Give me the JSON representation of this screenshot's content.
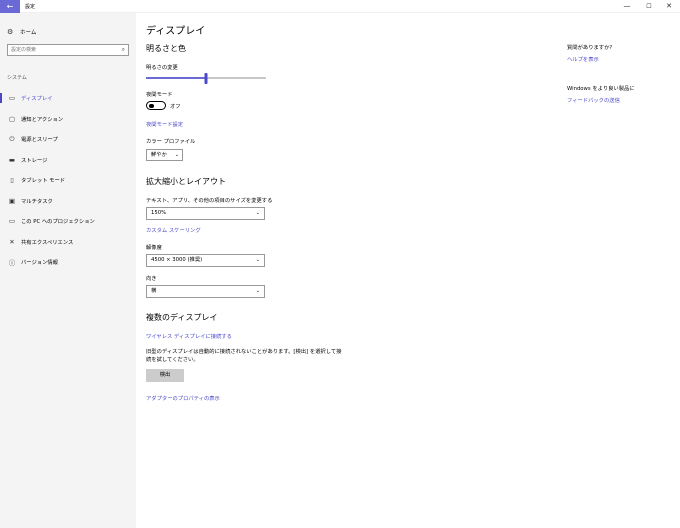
{
  "window": {
    "back_glyph": "←",
    "title": "設定",
    "minimize_glyph": "—",
    "maximize_glyph": "☐",
    "close_glyph": "✕"
  },
  "sidebar": {
    "home": {
      "icon": "gear-icon",
      "glyph": "⚙",
      "label": "ホーム"
    },
    "search": {
      "placeholder": "設定の検索",
      "icon_glyph": "⌕"
    },
    "section_label": "システム",
    "items": [
      {
        "icon": "display-icon",
        "glyph": "▭",
        "label": "ディスプレイ",
        "active": true
      },
      {
        "icon": "notification-icon",
        "glyph": "▢",
        "label": "通知とアクション"
      },
      {
        "icon": "power-icon",
        "glyph": "⏻",
        "label": "電源とスリープ"
      },
      {
        "icon": "storage-icon",
        "glyph": "▬",
        "label": "ストレージ"
      },
      {
        "icon": "tablet-mode-icon",
        "glyph": "▯",
        "label": "タブレット モード"
      },
      {
        "icon": "multitasking-icon",
        "glyph": "▣",
        "label": "マルチタスク"
      },
      {
        "icon": "projection-icon",
        "glyph": "▭",
        "label": "この PC へのプロジェクション"
      },
      {
        "icon": "shared-experiences-icon",
        "glyph": "✕",
        "label": "共有エクスペリエンス"
      },
      {
        "icon": "info-icon",
        "glyph": "ⓘ",
        "label": "バージョン情報"
      }
    ]
  },
  "main": {
    "title": "ディスプレイ",
    "brightness_section": "明るさと色",
    "brightness_label": "明るさの変更",
    "brightness_value": 0.5,
    "accent_color": "#6b69d6",
    "night_mode_label": "夜間モード",
    "night_mode_state": "オフ",
    "night_mode_settings_link": "夜間モード設定",
    "color_profile_label": "カラー プロファイル",
    "color_profile_value": "鮮やか",
    "scale_section": "拡大縮小とレイアウト",
    "scale_label": "テキスト、アプリ、その他の項目のサイズを変更する",
    "scale_value": "150%",
    "custom_scaling_link": "カスタム スケーリング",
    "resolution_label": "解像度",
    "resolution_value": "4500 × 3000 (推奨)",
    "orientation_label": "向き",
    "orientation_value": "横",
    "multi_display_section": "複数のディスプレイ",
    "wireless_link": "ワイヤレス ディスプレイに接続する",
    "detect_desc": "旧型のディスプレイは自動的に接続されないことがあります。[検出] を選択して接続を試してください。",
    "detect_button": "検出",
    "adapter_link": "アダプターのプロパティの表示"
  },
  "right_panel": {
    "question": "質問がありますか?",
    "help_link": "ヘルプを表示",
    "improve_text": "Windows をより良い製品に",
    "feedback_link": "フィードバックの送信"
  }
}
